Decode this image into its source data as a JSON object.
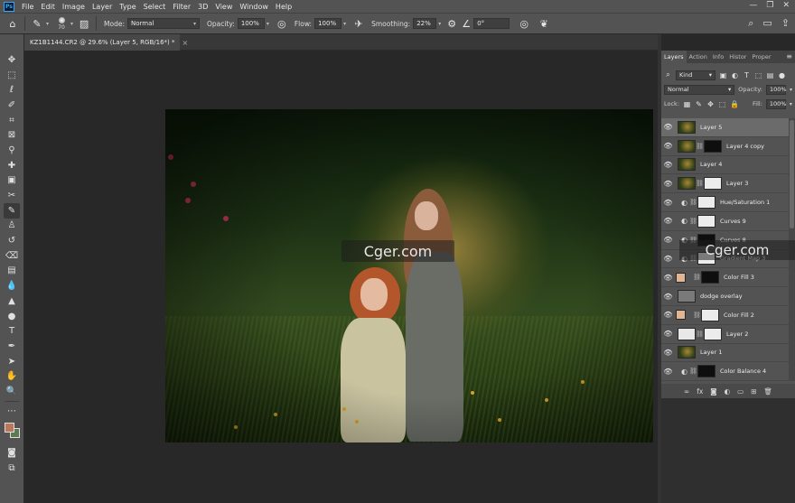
{
  "menu": {
    "logo": "Ps",
    "items": [
      "File",
      "Edit",
      "Image",
      "Layer",
      "Type",
      "Select",
      "Filter",
      "3D",
      "View",
      "Window",
      "Help"
    ],
    "window_controls": [
      "—",
      "❐",
      "✕"
    ]
  },
  "options": {
    "brush_size": "70",
    "mode_label": "Mode:",
    "mode_value": "Normal",
    "opacity_label": "Opacity:",
    "opacity_value": "100%",
    "flow_label": "Flow:",
    "flow_value": "100%",
    "smoothing_label": "Smoothing:",
    "smoothing_value": "22%",
    "angle_value": "0°"
  },
  "document": {
    "tab_title": "KZ1B1144.CR2 @ 29.6% (Layer 5, RGB/16*) *",
    "close": "×"
  },
  "watermark": {
    "canvas_text": "Cger.com",
    "panel_text": "Cger.com"
  },
  "panel": {
    "tabs": [
      "Layers",
      "Action",
      "Info",
      "Histor",
      "Proper"
    ],
    "menu_icon": "≡",
    "filter_kind": "Kind",
    "blend_mode": "Normal",
    "opacity_label": "Opacity:",
    "opacity_value": "100%",
    "lock_label": "Lock:",
    "fill_label": "Fill:",
    "fill_value": "100%",
    "layers": [
      {
        "name": "Layer 5",
        "thumb": "photo",
        "mask": "",
        "adjustment": false,
        "selected": true
      },
      {
        "name": "Layer 4 copy",
        "thumb": "photo",
        "mask": "black",
        "adjustment": false,
        "selected": false
      },
      {
        "name": "Layer 4",
        "thumb": "photo",
        "mask": "",
        "adjustment": false,
        "selected": false
      },
      {
        "name": "Layer 3",
        "thumb": "photo",
        "mask": "white",
        "adjustment": false,
        "selected": false
      },
      {
        "name": "Hue/Saturation 1",
        "thumb": "white",
        "mask": "",
        "adjustment": true,
        "selected": false
      },
      {
        "name": "Curves 9",
        "thumb": "white",
        "mask": "",
        "adjustment": true,
        "selected": false
      },
      {
        "name": "Curves 8",
        "thumb": "black",
        "mask": "",
        "adjustment": true,
        "selected": false
      },
      {
        "name": "Gradient Map 3",
        "thumb": "white",
        "mask": "",
        "adjustment": true,
        "selected": false
      },
      {
        "name": "Color Fill 3",
        "thumb": "peach",
        "mask": "black",
        "adjustment": false,
        "selected": false
      },
      {
        "name": "dodge overlay",
        "thumb": "gray",
        "mask": "",
        "adjustment": false,
        "selected": false
      },
      {
        "name": "Color Fill 2",
        "thumb": "peach",
        "mask": "white",
        "adjustment": false,
        "selected": false
      },
      {
        "name": "Layer 2",
        "thumb": "white",
        "mask": "white",
        "adjustment": false,
        "selected": false
      },
      {
        "name": "Layer 1",
        "thumb": "photo",
        "mask": "",
        "adjustment": false,
        "selected": false
      },
      {
        "name": "Color Balance 4",
        "thumb": "black",
        "mask": "",
        "adjustment": true,
        "selected": false
      }
    ],
    "footer_icons": [
      "link-icon",
      "fx-icon",
      "mask-icon",
      "adjustment-icon",
      "folder-icon",
      "new-layer-icon",
      "trash-icon"
    ]
  },
  "colors": {
    "foreground": "#b97859",
    "background": "#5e7a52"
  }
}
